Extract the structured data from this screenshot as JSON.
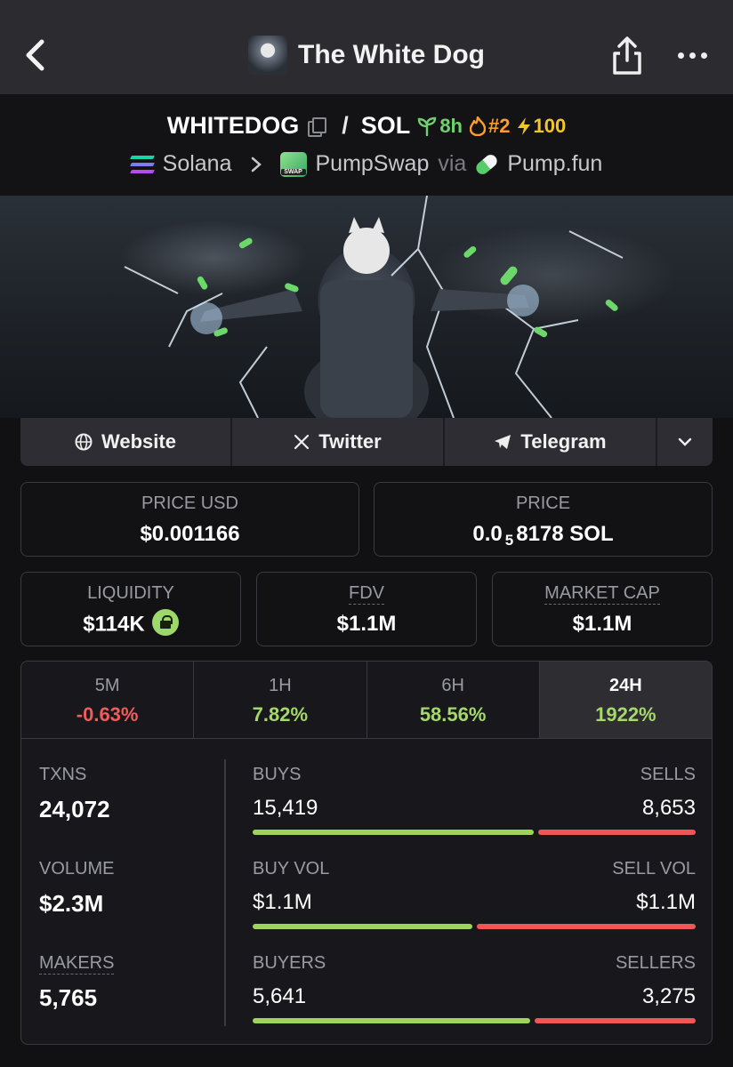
{
  "header": {
    "title": "The White Dog",
    "icons": [
      "back-icon",
      "share-icon",
      "more-icon"
    ]
  },
  "pair": {
    "base": "WHITEDOG",
    "quote": "SOL",
    "slash": "/",
    "age": "8h",
    "rank": "#2",
    "boost": "100",
    "chain": "Solana",
    "dex": "PumpSwap",
    "via": "via",
    "launchpad": "Pump.fun",
    "colors": {
      "age": "#6fd26f",
      "rank": "#ff9d2c",
      "boost": "#f2c623"
    }
  },
  "links": [
    {
      "label": "Website",
      "icon": "globe-icon"
    },
    {
      "label": "Twitter",
      "icon": "x-logo-icon"
    },
    {
      "label": "Telegram",
      "icon": "telegram-icon"
    }
  ],
  "prices": {
    "price_usd_label": "PRICE USD",
    "price_usd": "$0.001166",
    "price_label": "PRICE",
    "price_sol_prefix": "0.0",
    "price_sol_zeros": "5",
    "price_sol_digits": "8178 SOL"
  },
  "metrics": {
    "liquidity_label": "LIQUIDITY",
    "liquidity": "$114K",
    "fdv_label": "FDV",
    "fdv": "$1.1M",
    "mcap_label": "MARKET CAP",
    "mcap": "$1.1M"
  },
  "timeframes": [
    {
      "label": "5M",
      "value": "-0.63%",
      "direction": "down"
    },
    {
      "label": "1H",
      "value": "7.82%",
      "direction": "up"
    },
    {
      "label": "6H",
      "value": "58.56%",
      "direction": "up"
    },
    {
      "label": "24H",
      "value": "1922%",
      "direction": "up",
      "selected": true
    }
  ],
  "stats": {
    "txns_label": "TXNS",
    "txns": "24,072",
    "volume_label": "VOLUME",
    "volume": "$2.3M",
    "makers_label": "MAKERS",
    "makers": "5,765",
    "buys_label": "BUYS",
    "buys": "15,419",
    "sells_label": "SELLS",
    "sells": "8,653",
    "buy_vol_label": "BUY VOL",
    "buy_vol": "$1.1M",
    "sell_vol_label": "SELL VOL",
    "sell_vol": "$1.1M",
    "buyers_label": "BUYERS",
    "buyers": "5,641",
    "sellers_label": "SELLERS",
    "sellers": "3,275",
    "ratios": {
      "buys": 0.64,
      "buy_vol": 0.5,
      "buyers": 0.633
    }
  },
  "colors": {
    "positive": "#a4d86a",
    "negative": "#f15b5b",
    "buy_bar": "#9fd45b",
    "sell_bar": "#ef5656"
  }
}
